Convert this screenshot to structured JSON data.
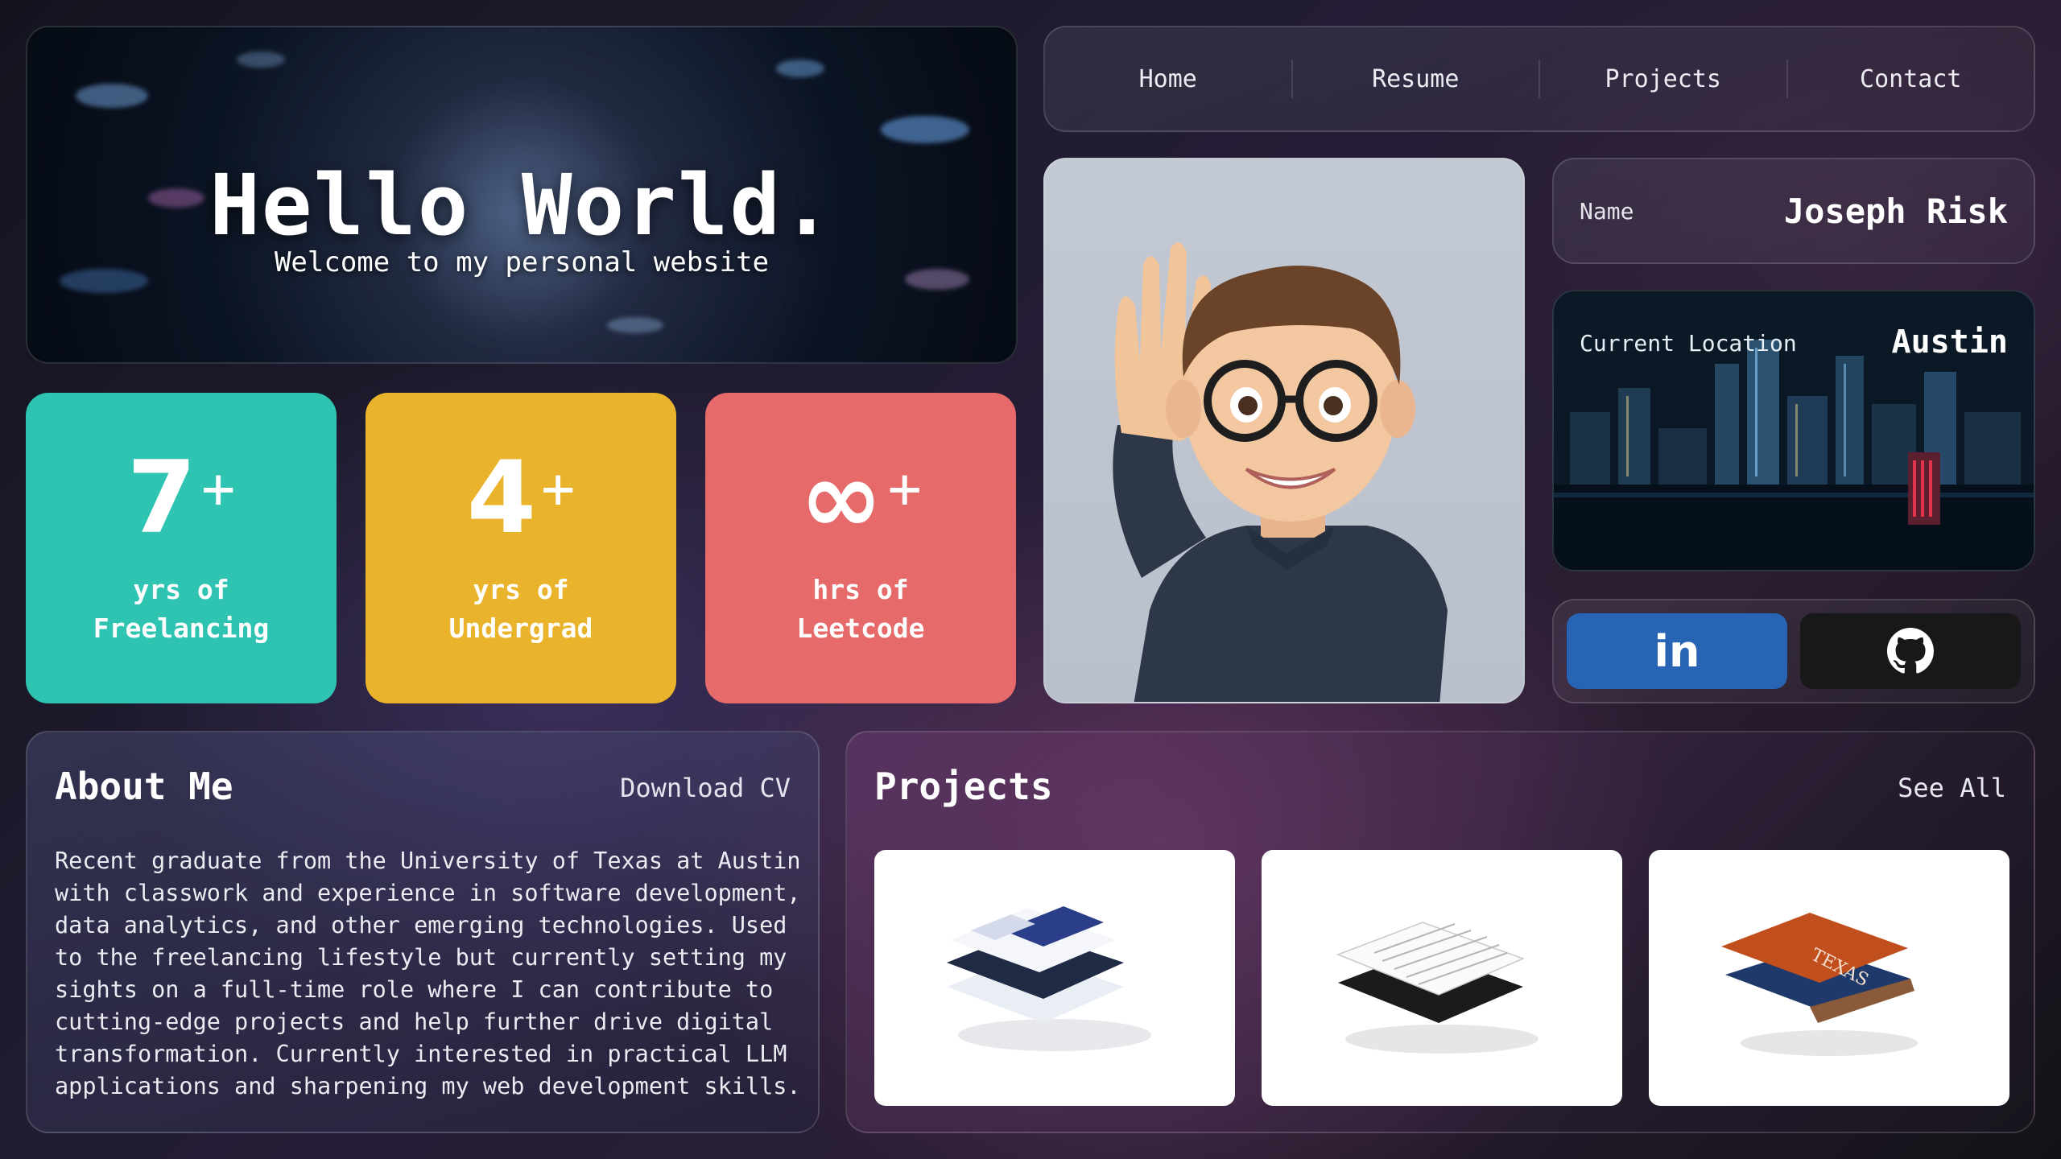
{
  "hero": {
    "title": "Hello World.",
    "subtitle": "Welcome to my personal website"
  },
  "nav": {
    "items": [
      {
        "label": "Home"
      },
      {
        "label": "Resume"
      },
      {
        "label": "Projects"
      },
      {
        "label": "Contact"
      }
    ]
  },
  "stats": [
    {
      "value": "7",
      "suffix": "+",
      "line1": "yrs of",
      "line2": "Freelancing",
      "color": "#2ec4b1"
    },
    {
      "value": "4",
      "suffix": "+",
      "line1": "yrs of",
      "line2": "Undergrad",
      "color": "#e9b42b"
    },
    {
      "value": "∞",
      "suffix": "+",
      "line1": "hrs of",
      "line2": "Leetcode",
      "color": "#e66a6a"
    }
  ],
  "profile": {
    "name_label": "Name",
    "name_value": "Joseph Risk",
    "location_label": "Current Location",
    "location_value": "Austin"
  },
  "social": {
    "linkedin_icon": "linkedin-icon",
    "linkedin_text": "in",
    "linkedin_color": "#2765b4",
    "github_icon": "github-icon",
    "github_color": "#181818"
  },
  "about": {
    "title": "About Me",
    "cv_label": "Download CV",
    "lines": [
      "Recent graduate from the University of Texas at Austin",
      "with classwork and experience in software development,",
      "data analytics, and other emerging technologies. Used",
      "to the freelancing lifestyle but currently setting my",
      "sights on a full-time role where I can contribute to",
      "cutting-edge projects and help further drive digital",
      "transformation. Currently interested in practical LLM",
      "applications and sharpening my web development skills."
    ]
  },
  "projects": {
    "title": "Projects",
    "see_all_label": "See All",
    "tiles": [
      {
        "name": "project-tile-portfolio"
      },
      {
        "name": "project-tile-documents"
      },
      {
        "name": "project-tile-texas",
        "stamp": "TEXAS"
      }
    ]
  }
}
